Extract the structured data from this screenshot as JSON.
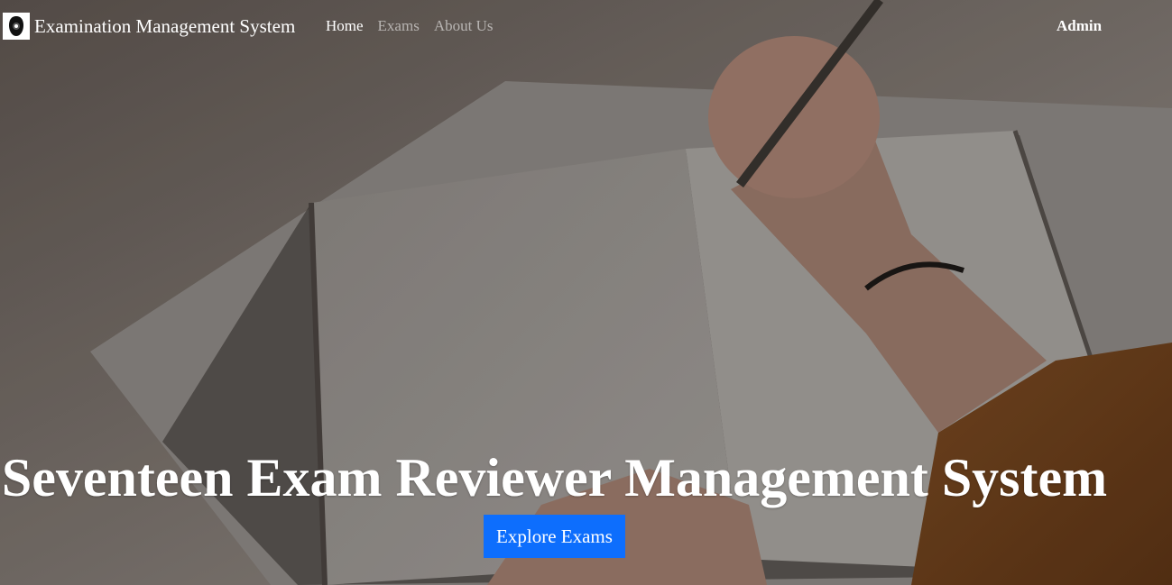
{
  "navbar": {
    "brand_name": "Examination Management System",
    "links": [
      {
        "label": "Home",
        "active": true
      },
      {
        "label": "Exams",
        "active": false
      },
      {
        "label": "About Us",
        "active": false
      }
    ],
    "admin_label": "Admin"
  },
  "hero": {
    "title": "Seventeen Exam Reviewer Management System",
    "cta_label": "Explore Exams",
    "background_image": "person-writing-in-notebook-photo"
  },
  "colors": {
    "primary": "#0d6efd",
    "nav_text": "#ffffff",
    "nav_muted": "rgba(255,255,255,0.55)"
  },
  "icons": {
    "brand_logo": "brand-logo-icon"
  }
}
